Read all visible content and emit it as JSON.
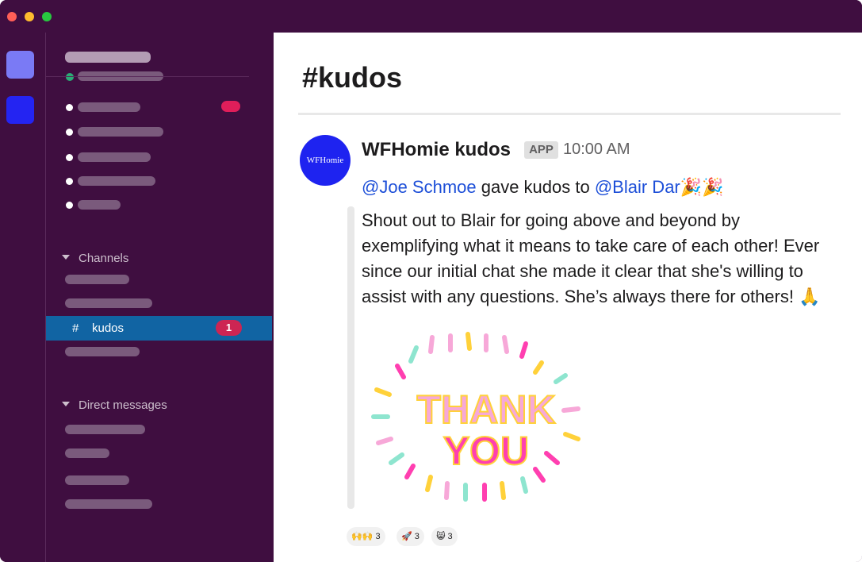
{
  "window": {
    "traffic_lights": [
      "#ff5f57",
      "#febc2e",
      "#28c840"
    ]
  },
  "rail": {
    "workspace_colors": [
      "#7a7af5",
      "#2424f2"
    ]
  },
  "sidebar": {
    "channels_label": "Channels",
    "dms_label": "Direct messages",
    "active_channel": {
      "hash": "#",
      "name": "kudos",
      "badge": "1"
    }
  },
  "channel": {
    "title": "#kudos"
  },
  "message": {
    "avatar_text": "WFHomie",
    "sender": "WFHomie kudos",
    "app_badge": "APP",
    "time": "10:00 AM",
    "giver": "@Joe Schmoe",
    "gave_text": " gave kudos to ",
    "receiver": "@Blair Dar",
    "party_emoji": "🎉🎉",
    "body": "Shout out to Blair for going above and beyond by exemplifying what it means to take care of each other! Ever since our initial chat she made it clear that she's willing to assist with any questions. She’s always there for others! 🙏",
    "image_text": [
      "THANK",
      "YOU"
    ]
  },
  "reactions": [
    {
      "emoji": "🙌🙌",
      "count": "3"
    },
    {
      "emoji": "🚀",
      "count": "3"
    },
    {
      "emoji": "😸",
      "count": "3"
    }
  ],
  "colors": {
    "sidebar": "#3f0e40",
    "active": "#1164a3",
    "badge": "#cd2553",
    "mention": "#1d4fd8",
    "avatar": "#1e23f0"
  }
}
